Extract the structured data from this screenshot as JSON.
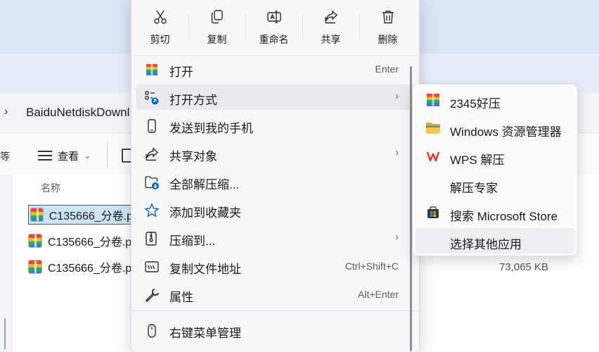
{
  "explorer": {
    "breadcrumb_chevron": "›",
    "breadcrumb_text": "BaiduNetdiskDownl",
    "toolbar_partial": "等",
    "view_label": "查看",
    "view_chevron": "⌄",
    "column_name": "名称",
    "files": [
      {
        "name": "C135666_分卷.p",
        "selected": true
      },
      {
        "name": "C135666_分卷.p",
        "selected": false
      },
      {
        "name": "C135666_分卷.p",
        "selected": false
      }
    ],
    "file_size": "73,065 KB"
  },
  "quick_actions": [
    {
      "label": "剪切",
      "icon": "scissors-icon"
    },
    {
      "label": "复制",
      "icon": "copy-icon"
    },
    {
      "label": "重命名",
      "icon": "rename-icon"
    },
    {
      "label": "共享",
      "icon": "share-icon"
    },
    {
      "label": "删除",
      "icon": "trash-icon"
    }
  ],
  "menu": {
    "items": [
      {
        "label": "打开",
        "shortcut": "Enter",
        "icon": "archive-app-icon"
      },
      {
        "label": "打开方式",
        "arrow": "›",
        "icon": "open-with-icon"
      },
      {
        "label": "发送到我的手机",
        "icon": "phone-icon"
      },
      {
        "label": "共享对象",
        "arrow": "›",
        "icon": "share-icon"
      },
      {
        "label": "全部解压缩...",
        "icon": "extract-folder-icon"
      },
      {
        "label": "添加到收藏夹",
        "icon": "star-icon"
      },
      {
        "label": "压缩到...",
        "arrow": "›",
        "icon": "compress-icon"
      },
      {
        "label": "复制文件地址",
        "shortcut": "Ctrl+Shift+C",
        "icon": "copy-path-icon"
      },
      {
        "label": "属性",
        "shortcut": "Alt+Enter",
        "icon": "wrench-icon"
      },
      {
        "label": "右键菜单管理",
        "icon": "mouse-icon"
      }
    ]
  },
  "submenu": {
    "items": [
      {
        "label": "2345好压",
        "icon": "haozip-icon"
      },
      {
        "label": "Windows 资源管理器",
        "icon": "folder-icon"
      },
      {
        "label": "WPS 解压",
        "icon": "wps-icon"
      },
      {
        "label": "解压专家",
        "icon": ""
      },
      {
        "label": "搜索 Microsoft Store",
        "icon": "store-icon"
      },
      {
        "label": "选择其他应用",
        "icon": ""
      }
    ]
  },
  "colors": {
    "accent": "#0067c0",
    "hover": "#e9ebef",
    "wps_red": "#e2372c"
  }
}
